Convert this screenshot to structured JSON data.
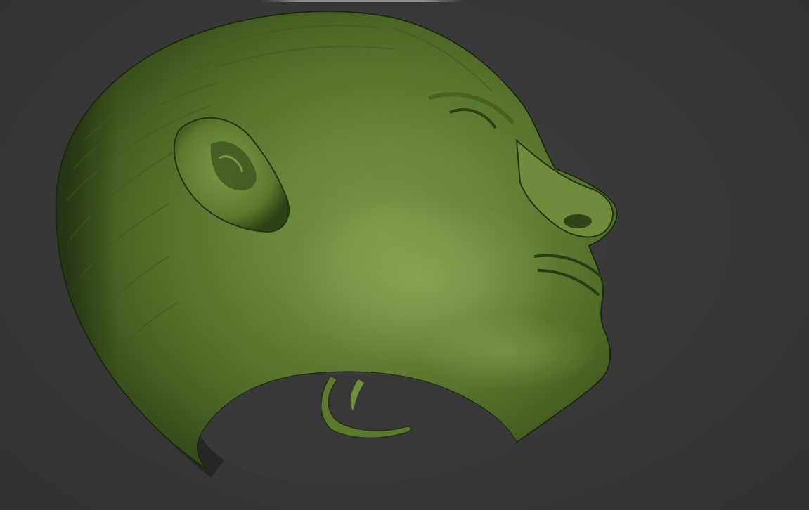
{
  "viewport": {
    "background_color": "#383838",
    "model": {
      "subject": "3d-scanned-human-head",
      "material_color": "#5e7d32",
      "highlight_color": "#8fae5a",
      "shadow_color": "#1e2a10"
    }
  }
}
